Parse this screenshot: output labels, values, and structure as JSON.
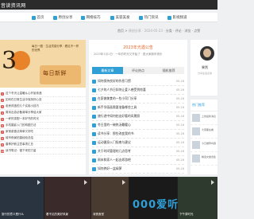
{
  "brand": {
    "logo_text": "音读资讯网"
  },
  "nav": {
    "items": [
      {
        "label": "首页",
        "icon": "home-icon"
      },
      {
        "label": "原创分享",
        "icon": "share-icon"
      },
      {
        "label": "网络技巧",
        "icon": "wrench-icon"
      },
      {
        "label": "美容美发",
        "icon": "scissors-icon"
      },
      {
        "label": "热门资讯",
        "icon": "fire-icon"
      },
      {
        "label": "影视频道",
        "icon": "film-icon"
      }
    ]
  },
  "breadcrumb": {
    "prefix": "首页 >",
    "dim": "原创分享 · 2024-05-23 ·",
    "meta": "分类 · 评论 · 浏览 · 点赞"
  },
  "banner": {
    "big_number": "3",
    "subline": "每日一图 · 生活灵感分享 · 看见不一样的世界",
    "cn_text": "每日新鲜"
  },
  "news": {
    "items": [
      {
        "num": "1",
        "text": "这个冬天让温暖从心开始传递"
      },
      {
        "num": "2",
        "text": "如何在日常生活中保持好心态"
      },
      {
        "num": "3",
        "text": "老房改造的几个实用小技巧"
      },
      {
        "num": "4",
        "text": "周末出游必备清单分享给大家"
      },
      {
        "num": "5",
        "text": "一杯热茶配一本好书的时光"
      },
      {
        "num": "6",
        "text": "手机摄影入门的构图方法"
      },
      {
        "num": "7",
        "text": "家常菜做法简单又好吃"
      },
      {
        "num": "8",
        "text": "城市夜景拍摄经验总结"
      },
      {
        "num": "9",
        "text": "春季护肤注意事项汇总"
      },
      {
        "num": "10",
        "text": "读书笔记：慢下来的力量"
      }
    ]
  },
  "modal": {
    "title": "2023年光遇公告",
    "subtitle": "2023年1月1日 · 一年的时光又开始了 · 愿大家新年快乐"
  },
  "tabs": [
    {
      "label": "最新文章",
      "active": true
    },
    {
      "label": "评论热点"
    },
    {
      "label": "随机推荐"
    }
  ],
  "list": {
    "rows": [
      {
        "title": "如何保持良好的作息习惯",
        "date": "05-16"
      },
      {
        "title": "七夕的人节日如何让爱人感受到惊喜",
        "date": "05-16"
      },
      {
        "title": "在家做美食的一些小窍门分享",
        "date": "05-16"
      },
      {
        "title": "新手学画画需要准备哪些工具",
        "date": "05-16"
      },
      {
        "title": "旅行途中如何拍出好看的风景照",
        "date": "05-16"
      },
      {
        "title": "冬日里的一碗热汤最暖心",
        "date": "05-16"
      },
      {
        "title": "读书分享：那些改变我的书",
        "date": "05-16"
      },
      {
        "title": "运动健身入门指南与建议",
        "date": "05-16"
      },
      {
        "title": "关于时间管理的几点思考",
        "date": "05-16"
      },
      {
        "title": "周末和家人一起去郊游吧",
        "date": "05-16"
      },
      {
        "title": "如何养好一盆绿萝",
        "date": "05-16"
      }
    ]
  },
  "author": {
    "name": "果然",
    "desc": "分享生活点滴"
  },
  "sidebar": {
    "head": "热门推荐",
    "items": [
      {
        "text": "上线最新消息"
      },
      {
        "text": "大家都在看"
      },
      {
        "text": "今日推荐内容"
      },
      {
        "text": "精选文章合集"
      }
    ]
  },
  "bottom": {
    "tiles": [
      {
        "caption": "旅行的意义是什么"
      },
      {
        "caption": "看不见的美好风景"
      },
      {
        "caption": "深夜食堂"
      },
      {
        "caption": "000爱听"
      },
      {
        "caption": "下午茶时光"
      }
    ]
  },
  "colors": {
    "accent": "#2f9fd6",
    "topbar": "#2b2b2b",
    "highlight": "#e26a2c"
  }
}
